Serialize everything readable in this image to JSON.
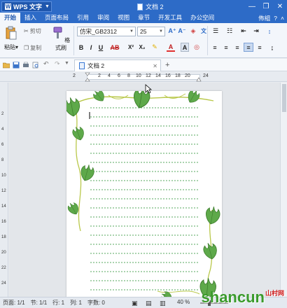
{
  "titlebar": {
    "app_name": "WPS 文字",
    "doc_title": "文档 2"
  },
  "menu": {
    "items": [
      "开始",
      "插入",
      "页面布局",
      "引用",
      "审阅",
      "视图",
      "章节",
      "开发工具",
      "办公空间"
    ],
    "active": "开始",
    "extra": "佈組"
  },
  "ribbon": {
    "paste": "粘贴",
    "cut": "剪切",
    "copy": "复制",
    "format_painter": "格式刷",
    "font_name": "仿宋_GB2312",
    "font_size": "25",
    "bold": "B",
    "italic": "I",
    "underline": "U",
    "strike": "AB",
    "superscript": "X²",
    "subscript": "X₂",
    "font_color": "A",
    "char_a": "A"
  },
  "doc_tab": {
    "label": "文档 2"
  },
  "ruler": {
    "numbers": [
      "2",
      "2",
      "4",
      "6",
      "8",
      "10",
      "12",
      "14",
      "16",
      "18",
      "20",
      "24"
    ]
  },
  "vruler": {
    "numbers": [
      "2",
      "4",
      "6",
      "8",
      "10",
      "12",
      "14",
      "16",
      "18",
      "20",
      "22",
      "24"
    ]
  },
  "status": {
    "page": "页面: 1/1",
    "section": "节: 1/1",
    "row": "行: 1",
    "col": "列: 1",
    "words": "字数: 0",
    "zoom": "40 %"
  },
  "watermark": {
    "text": "shancun",
    "sub": "山村网"
  },
  "colors": {
    "title_blue": "#2d6bc7",
    "leaf_green": "#5ea94a",
    "vine_yellow": "#b9c84a",
    "line_green": "#1f8a2a"
  }
}
